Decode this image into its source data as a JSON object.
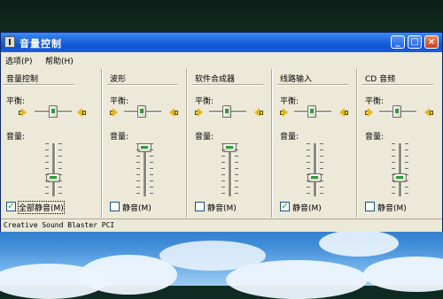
{
  "window": {
    "title": "音量控制"
  },
  "menu": {
    "options": "选项(P)",
    "help": "帮助(H)"
  },
  "labels": {
    "balance": "平衡:",
    "volume": "音量:"
  },
  "columns": [
    {
      "title": "音量控制",
      "mute_label": "全部静音(M)",
      "muted": true
    },
    {
      "title": "波形",
      "mute_label": "静音(M)",
      "muted": false
    },
    {
      "title": "软件合成器",
      "mute_label": "静音(M)",
      "muted": false
    },
    {
      "title": "线路输入",
      "mute_label": "静音(M)",
      "muted": true
    },
    {
      "title": "CD 音频",
      "mute_label": "静音(M)",
      "muted": false
    }
  ],
  "status": {
    "text": "Creative Sound Blaster PCI"
  },
  "colors": {
    "titlebar": "#1c63dd",
    "window_bg": "#ece9d8",
    "slider_green": "#2f9b3a"
  },
  "icons": [
    "volume-app-icon",
    "speaker-left-icon",
    "speaker-right-icon",
    "checkbox-check-icon"
  ]
}
